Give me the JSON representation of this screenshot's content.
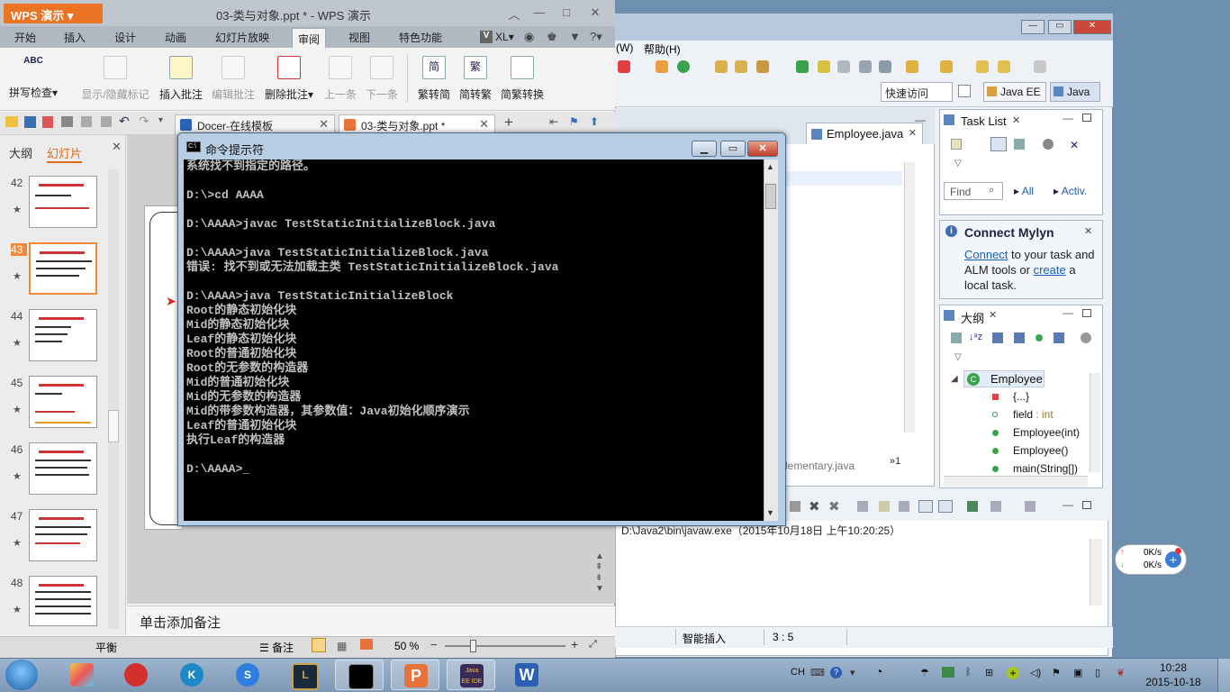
{
  "wps": {
    "app_button": "WPS 演示",
    "doc_title": "03-类与对象.ppt * - WPS 演示",
    "menu_tabs": [
      "开始",
      "插入",
      "设计",
      "动画",
      "幻灯片放映",
      "审阅",
      "视图",
      "特色功能"
    ],
    "active_tab": "审阅",
    "account": "XL",
    "ribbon": [
      {
        "label": "拼写检查",
        "enabled": true
      },
      {
        "label": "显示/隐藏标记",
        "enabled": false
      },
      {
        "label": "插入批注",
        "enabled": true
      },
      {
        "label": "编辑批注",
        "enabled": false
      },
      {
        "label": "删除批注",
        "enabled": true
      },
      {
        "label": "上一条",
        "enabled": false
      },
      {
        "label": "下一条",
        "enabled": false
      },
      {
        "label": "繁转简",
        "enabled": true
      },
      {
        "label": "简转繁",
        "enabled": true
      },
      {
        "label": "简繁转换",
        "enabled": true
      }
    ],
    "ribbon_icon_text": {
      "spell": "ABC",
      "t2s": "简",
      "s2t": "繁"
    },
    "doc_tabs": [
      "Docer-在线模板",
      "03-类与对象.ppt *"
    ],
    "left_tabs": {
      "outline": "大纲",
      "slides": "幻灯片"
    },
    "slide_numbers": [
      "42",
      "43",
      "44",
      "45",
      "46",
      "47",
      "48"
    ],
    "selected_slide": "43",
    "notes_placeholder": "单击添加备注",
    "status": {
      "left": "平衡",
      "notes": "备注",
      "zoom": "50 %"
    }
  },
  "eclipse": {
    "menu_partial": "(W)",
    "menu_help": "帮助(H)",
    "quick_access": "快速访问",
    "perspectives": [
      "Java EE",
      "Java"
    ],
    "editor_tab": "Employee.java",
    "editor_bottom_tab": "lementary.java",
    "editor_overflow": "»1",
    "task_list": {
      "title": "Task List",
      "find_placeholder": "Find",
      "all": "All",
      "activate": "Activ."
    },
    "mylyn": {
      "title": "Connect Mylyn",
      "link1": "Connect",
      "text1": " to your task and",
      "text2": "ALM tools or ",
      "link2": "create",
      "text3": " a",
      "text4": "local task."
    },
    "outline": {
      "title": "大纲",
      "items": [
        {
          "label": "Employee",
          "detail": ""
        },
        {
          "label": "{...}",
          "detail": ""
        },
        {
          "label": "field",
          "detail": " : int"
        },
        {
          "label": "Employee(int)",
          "detail": ""
        },
        {
          "label": "Employee()",
          "detail": ""
        },
        {
          "label": "main(String[])",
          "detail": ""
        }
      ]
    },
    "console_line": "D:\\Java2\\bin\\javaw.exe（2015年10月18日 上午10:20:25）",
    "status": {
      "insert": "智能插入",
      "position": "3 : 5"
    }
  },
  "cmd": {
    "title": "命令提示符",
    "icon_text": "C:\\",
    "lines": [
      "系统找不到指定的路径。",
      "",
      "D:\\>cd AAAA",
      "",
      "D:\\AAAA>javac TestStaticInitializeBlock.java",
      "",
      "D:\\AAAA>java TestStaticInitializeBlock.java",
      "错误: 找不到或无法加载主类 TestStaticInitializeBlock.java",
      "",
      "D:\\AAAA>java TestStaticInitializeBlock",
      "Root的静态初始化块",
      "Mid的静态初始化块",
      "Leaf的静态初始化块",
      "Root的普通初始化块",
      "Root的无参数的构造器",
      "Mid的普通初始化块",
      "Mid的无参数的构造器",
      "Mid的带参数构造器，其参数值：Java初始化顺序演示",
      "Leaf的普通初始化块",
      "执行Leaf的构造器",
      "",
      "D:\\AAAA>_"
    ]
  },
  "net_widget": {
    "up": "0K/s",
    "down": "0K/s"
  },
  "taskbar": {
    "tray_lang": "CH",
    "time": "10:28",
    "date": "2015-10-18",
    "app_java_ee": "Java EE IDE"
  }
}
